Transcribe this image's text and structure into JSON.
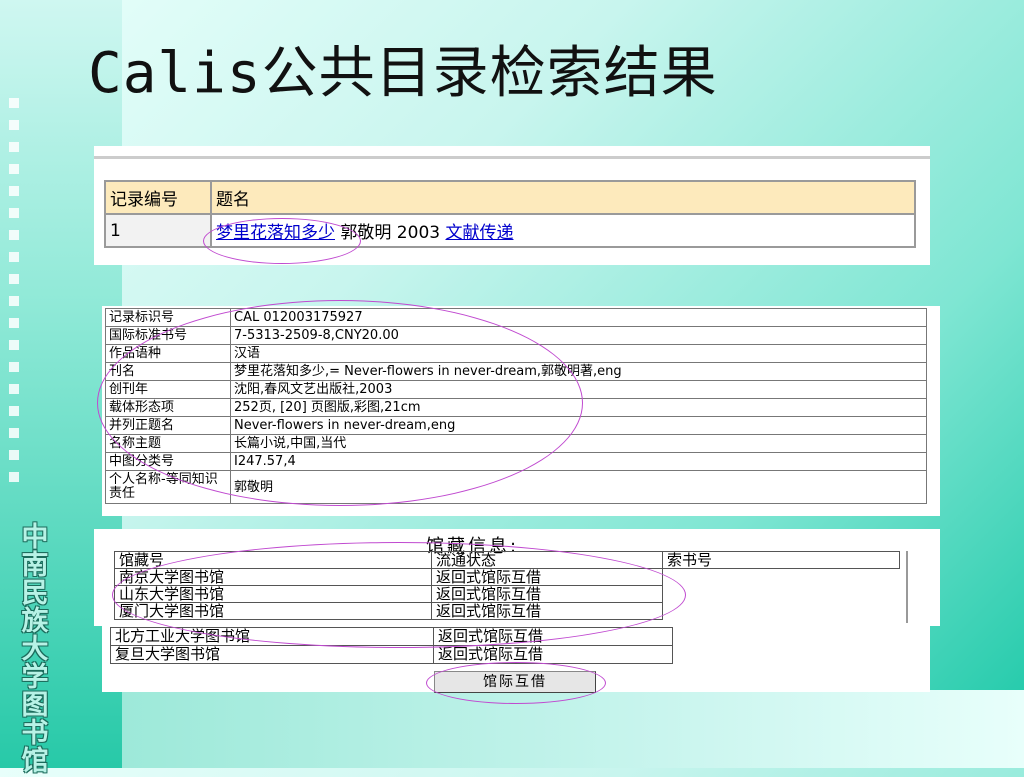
{
  "slide": {
    "title": "Calis公共目录检索结果",
    "vertical_name": [
      "中",
      "南",
      "民",
      "族",
      "大",
      "学",
      "图",
      "书",
      "馆"
    ]
  },
  "results": {
    "headers": [
      "记录编号",
      "题名"
    ],
    "row": {
      "num": "1",
      "title_link": "梦里花落知多少",
      "rest": " 郭敬明  2003 ",
      "delivery_link": "文献传递"
    }
  },
  "record": {
    "fields": [
      {
        "label": "记录标识号",
        "value": "CAL 012003175927"
      },
      {
        "label": "国际标准书号",
        "value": "7-5313-2509-8,CNY20.00"
      },
      {
        "label": "作品语种",
        "value": "汉语"
      },
      {
        "label": "刊名",
        "value": "梦里花落知多少,= Never-flowers in never-dream,郭敬明著,eng"
      },
      {
        "label": "创刊年",
        "value": "沈阳,春风文艺出版社,2003"
      },
      {
        "label": "载体形态项",
        "value": "252页, [20] 页图版,彩图,21cm"
      },
      {
        "label": "并列正题名",
        "value": "Never-flowers in never-dream,eng"
      },
      {
        "label": "名称主题",
        "value": "长篇小说,中国,当代"
      },
      {
        "label": "中图分类号",
        "value": "I247.57,4"
      },
      {
        "label": "个人名称-等同知识责任",
        "value": "郭敬明"
      }
    ]
  },
  "holdings": {
    "heading": "馆藏信息:",
    "headers": [
      "馆藏号",
      "流通状态",
      "索书号"
    ],
    "rows": [
      {
        "library": "南京大学图书馆",
        "status": "返回式馆际互借"
      },
      {
        "library": "山东大学图书馆",
        "status": "返回式馆际互借"
      },
      {
        "library": "厦门大学图书馆",
        "status": "返回式馆际互借"
      },
      {
        "library": "北方工业大学图书馆",
        "status": "返回式馆际互借"
      },
      {
        "library": "复旦大学图书馆",
        "status": "返回式馆际互借"
      }
    ],
    "button_label": "馆际互借"
  },
  "colors": {
    "annotation": "#c04ad0",
    "header_bg": "#fdeabc",
    "link": "#0000cc"
  }
}
